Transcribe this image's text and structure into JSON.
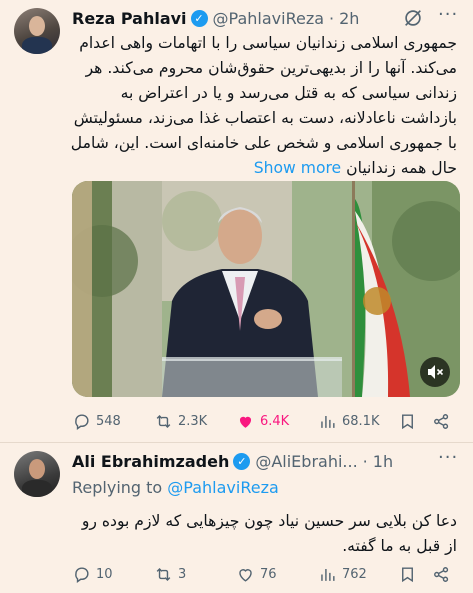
{
  "tweet1": {
    "name": "Reza Pahlavi",
    "handle": "@PahlaviReza",
    "sep": "·",
    "time": "2h",
    "more": "···",
    "body_lines": [
      "جمهوری اسلامی زندانیان سیاسی را با اتهامات واهی اعدام",
      "می‌کند. آنها را از بدیهی‌ترین حقوق‌شان محروم می‌کند. هر",
      "زندانی سیاسی که به قتل می‌رسد و یا در اعتراض به",
      "بازداشت ناعادلانه، دست به اعتصاب غذا می‌زند، مسئولیتش",
      "با جمهوری اسلامی و شخص علی خامنه‌ای است. این، شامل",
      "حال همه زندانیان"
    ],
    "show_more": "Show more",
    "stats": {
      "replies": "548",
      "reposts": "2.3K",
      "likes": "6.4K",
      "views": "68.1K"
    },
    "colors": {
      "like": "#f91880"
    }
  },
  "tweet2": {
    "name": "Ali Ebrahimzadeh",
    "handle": "@AliEbrahi...",
    "sep": "·",
    "time": "1h",
    "more": "···",
    "replying_label": "Replying to",
    "replying_handle": "@PahlaviReza",
    "body_lines": [
      "دعا کن بلایی سر حسین نیاد چون چیزهایی که لازم بوده رو",
      "از قبل به ما گفته."
    ],
    "stats": {
      "replies": "10",
      "reposts": "3",
      "likes": "76",
      "views": "762"
    }
  },
  "colors": {
    "background": "#fbf0e6",
    "accent": "#1d9bf0",
    "muted": "#536471"
  }
}
